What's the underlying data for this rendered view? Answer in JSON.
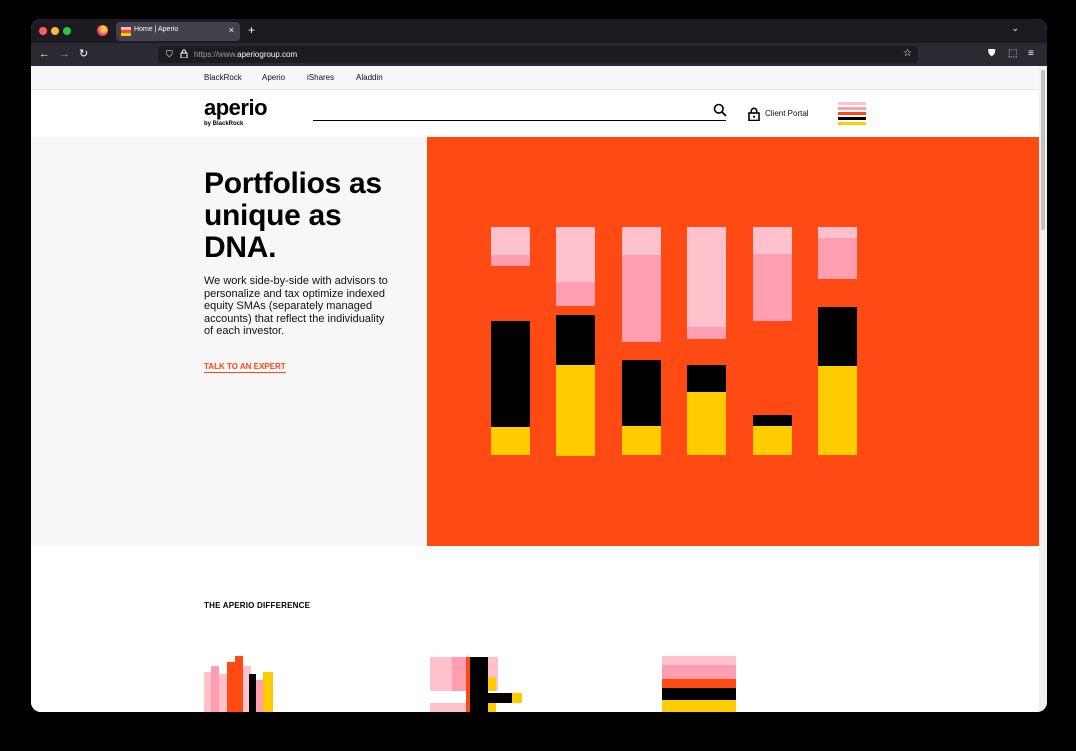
{
  "browser": {
    "tab_title": "Home | Aperio",
    "tab_close": "×",
    "new_tab": "+",
    "tab_list": "⌄",
    "url_prefix": "https://www.",
    "url_domain": "aperiogroup.com",
    "back": "←",
    "forward": "→",
    "reload": "↻",
    "star": "☆",
    "shield": "⛉",
    "pocket": "⛊",
    "extensions": "⬚",
    "menu": "≡"
  },
  "brandbar": {
    "links": [
      "BlackRock",
      "Aperio",
      "iShares",
      "Aladdin"
    ]
  },
  "header": {
    "logo": "aperio",
    "logo_sub": "by BlackRock",
    "client_portal": "Client Portal"
  },
  "hero": {
    "title": "Portfolios as unique as DNA.",
    "body": "We work side-by-side with advisors to personalize and tax optimize indexed equity SMAs (separately managed accounts) that reflect the individuality of each investor.",
    "cta": "TALK TO AN EXPERT"
  },
  "difference": {
    "heading": "THE APERIO DIFFERENCE"
  },
  "colors": {
    "orange": "#ff4a13",
    "light_pink": "#ffc2cc",
    "pink": "#ff9eb1",
    "black": "#000000",
    "yellow": "#ffcc00"
  }
}
